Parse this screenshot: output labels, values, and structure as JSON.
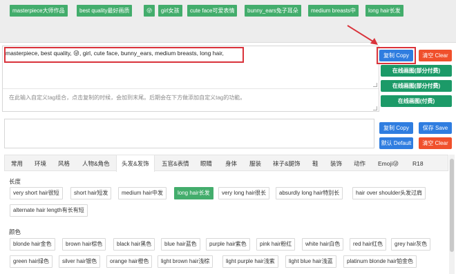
{
  "selected_tags": [
    "masterpiece大师作品",
    "best quality最好画质",
    "😜",
    "girl女孩",
    "cute face可爱表情",
    "bunny_ears兔子耳朵",
    "medium breasts中",
    "long hair长发"
  ],
  "prompt": {
    "value": "masterpiece, best quality, 😜, girl, cute face, bunny_ears, medium breasts, long hair,",
    "custom_placeholder": "在此输入自定义tag组合，点击复制的时候，会加到末尾。后期会在下方做添加自定义tag的功能。"
  },
  "buttons": {
    "copy": "复制 Copy",
    "clear": "清空 Clear",
    "online_partial_1": "在线画图(部分付费)",
    "online_partial_2": "在线画图(部分付费)",
    "online_paid": "在线画图(付费)",
    "copy2": "复制 Copy",
    "save": "保存 Save",
    "default": "默认 Default",
    "clear2": "清空 Clear"
  },
  "tabs": [
    "常用",
    "环境",
    "风格",
    "人物&角色",
    "头发&发饰",
    "五官&表情",
    "眼睛",
    "身体",
    "服装",
    "袜子&腿饰",
    "鞋",
    "装饰",
    "动作",
    "Emoji😜",
    "R18"
  ],
  "active_tab": "头发&发饰",
  "sections": {
    "length_label": "长度",
    "length_items": [
      "very short hair很短",
      "short hair短发",
      "medium hair中发",
      "long hair长发",
      "very long hair很长",
      "absurdly long hair特别长",
      "hair over shoulder头发过肩",
      "alternate hair length有长有短"
    ],
    "color_label": "颜色",
    "color_row1": [
      "blonde hair金色",
      "brown hair棕色",
      "black hair黑色",
      "blue hair蓝色",
      "purple hair紫色",
      "pink hair粉红",
      "white hair白色",
      "red hair红色",
      "grey hair灰色"
    ],
    "color_row2": [
      "green hair绿色",
      "silver hair银色",
      "orange hair橙色",
      "light brown hair浅棕",
      "light purple hair浅紫",
      "light blue hair浅蓝",
      "platinum blonde hair铂金色"
    ]
  },
  "colors": {
    "tag_green": "#43ad6c",
    "button_blue": "#2f7de0",
    "button_red": "#f0502c",
    "button_green": "#1c9a68",
    "annotation_red": "#d9323a"
  }
}
